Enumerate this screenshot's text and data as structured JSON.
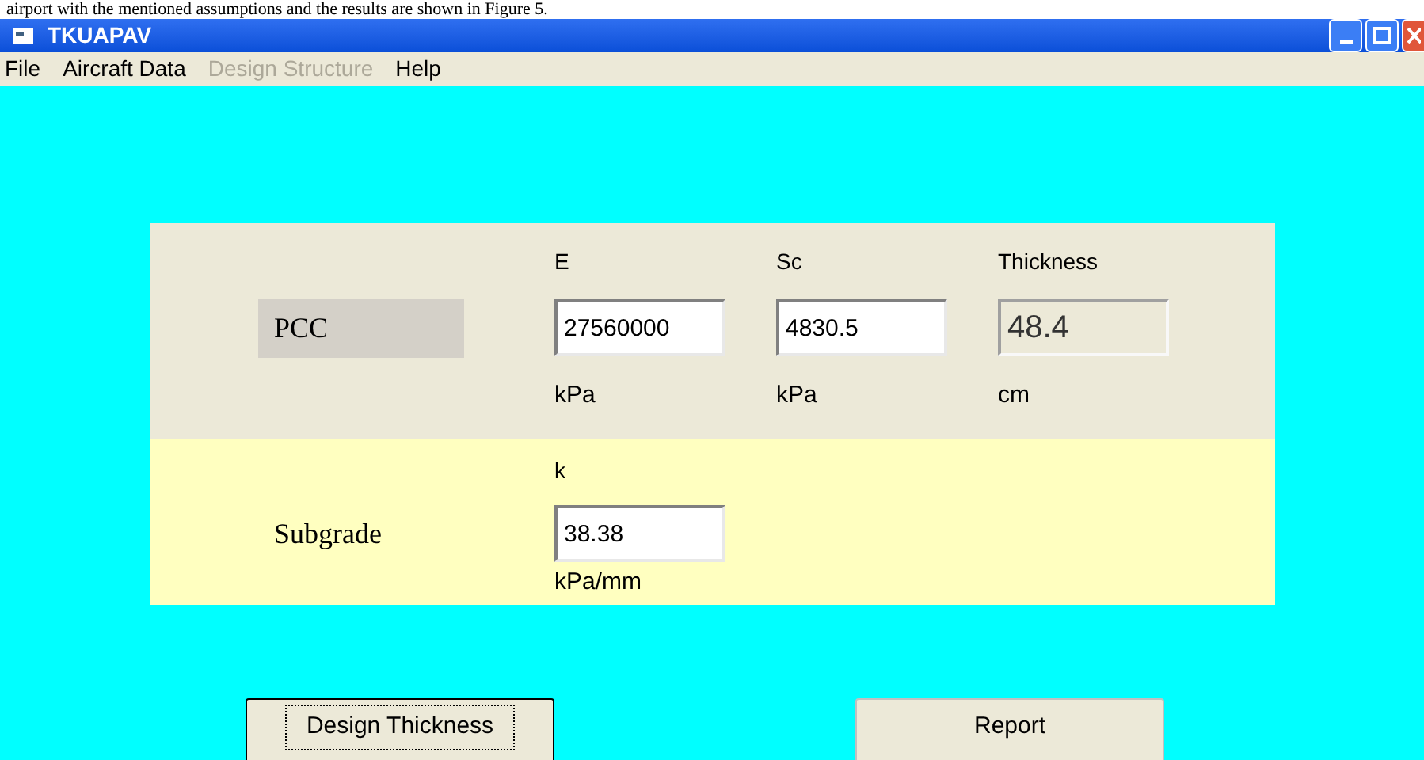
{
  "caption": "airport with the mentioned assumptions and the results are shown in Figure 5.",
  "window": {
    "title": "TKUAPAV"
  },
  "menu": [
    {
      "label": "File",
      "disabled": false
    },
    {
      "label": "Aircraft Data",
      "disabled": false
    },
    {
      "label": "Design Structure",
      "disabled": true
    },
    {
      "label": "Help",
      "disabled": false
    }
  ],
  "pcc": {
    "label": "PCC",
    "fields": [
      {
        "label": "E",
        "value": "27560000",
        "unit": "kPa",
        "readonly": false
      },
      {
        "label": "Sc",
        "value": "4830.5",
        "unit": "kPa",
        "readonly": false
      },
      {
        "label": "Thickness",
        "value": "48.4",
        "unit": "cm",
        "readonly": true
      }
    ]
  },
  "subgrade": {
    "label": "Subgrade",
    "fields": [
      {
        "label": "k",
        "value": "38.38",
        "unit": "kPa/mm",
        "readonly": false
      }
    ]
  },
  "buttons": [
    {
      "label": "Design Thickness",
      "focused": true
    },
    {
      "label": "Report",
      "focused": false
    }
  ]
}
